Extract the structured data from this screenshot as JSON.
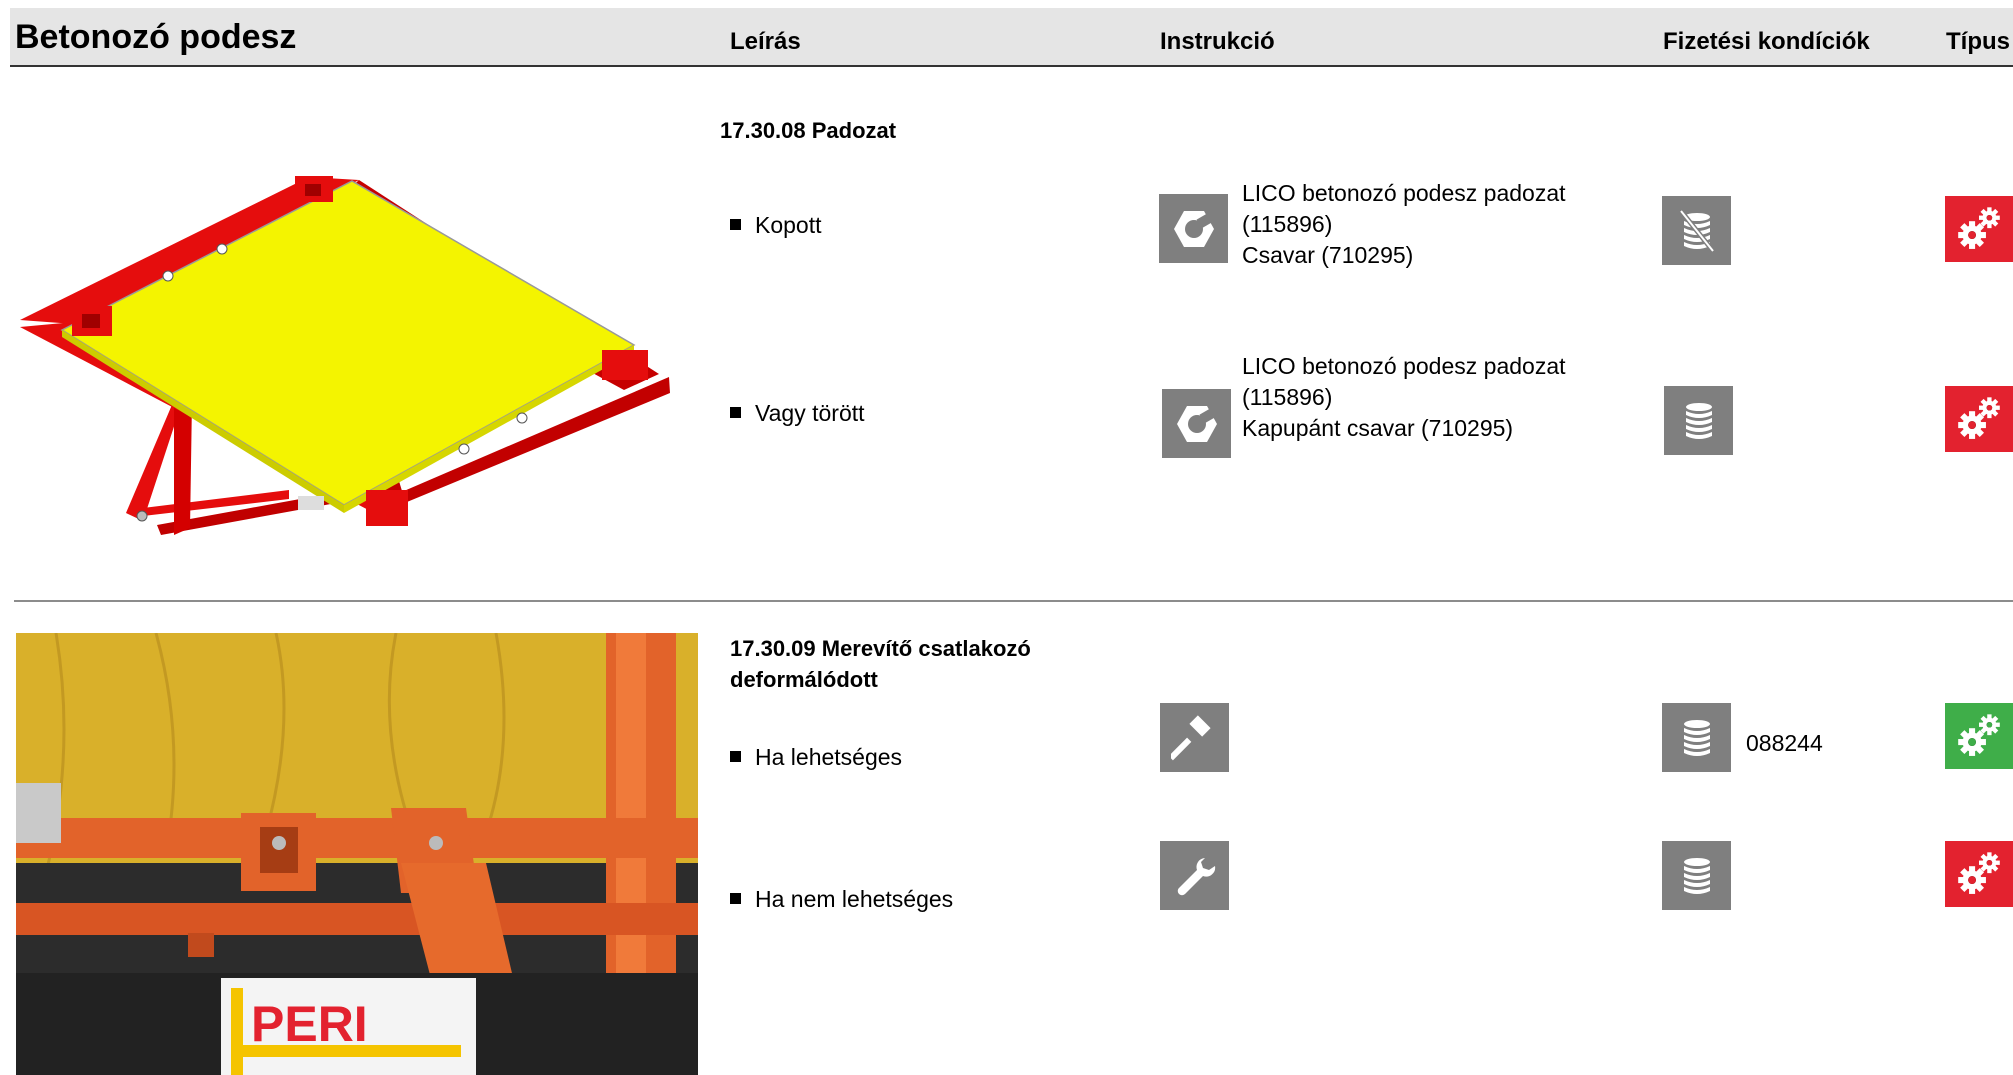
{
  "header": {
    "title": "Betonozó podesz",
    "col_description": "Leírás",
    "col_instruction": "Instrukció",
    "col_payment": "Fizetési kondíciók",
    "col_type": "Típus"
  },
  "sections": [
    {
      "title": "17.30.08 Padozat",
      "rows": [
        {
          "description": "Kopott",
          "instruction_icon": "hex-nut-icon",
          "instruction_lines": [
            "LICO  betonozó podesz padozat",
            "(115896)",
            "Csavar (710295)"
          ],
          "payment_icon": "coins-crossed-icon",
          "payment_code": "",
          "type_icon": "gears-icon",
          "type_color": "#e3222f"
        },
        {
          "description": "Vagy  törött",
          "instruction_icon": "hex-nut-icon",
          "instruction_lines": [
            "LICO  betonozó podesz padozat",
            "(115896)",
            "Kapupánt csavar (710295)"
          ],
          "payment_icon": "coins-icon",
          "payment_code": "",
          "type_icon": "gears-icon",
          "type_color": "#e3222f"
        }
      ]
    },
    {
      "title_lines": [
        "17.30.09 Merevítő csatlakozó",
        "deformálódott"
      ],
      "rows": [
        {
          "description": "Ha lehetséges",
          "instruction_icon": "hammer-icon",
          "payment_icon": "coins-icon",
          "payment_code": "088244",
          "type_icon": "gears-icon",
          "type_color": "#3fae49"
        },
        {
          "description": "Ha nem lehetséges",
          "instruction_icon": "wrench-icon",
          "payment_icon": "coins-icon",
          "payment_code": "",
          "type_icon": "gears-icon",
          "type_color": "#e3222f"
        }
      ]
    }
  ],
  "photo_logo_text": "PERI"
}
